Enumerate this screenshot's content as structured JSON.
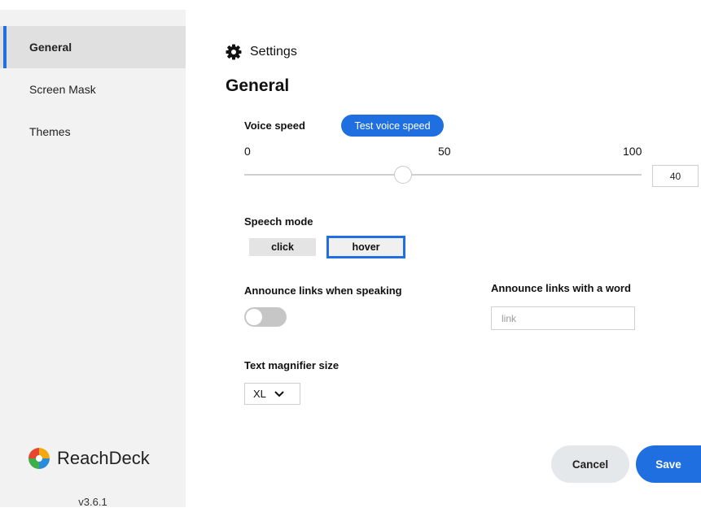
{
  "sidebar": {
    "items": [
      {
        "label": "General",
        "active": true
      },
      {
        "label": "Screen Mask",
        "active": false
      },
      {
        "label": "Themes",
        "active": false
      }
    ],
    "brand_name": "ReachDeck",
    "version": "v3.6.1"
  },
  "header": {
    "title": "Settings",
    "icon": "gear-icon"
  },
  "page_title": "General",
  "voice_speed": {
    "label": "Voice speed",
    "test_button": "Test voice speed",
    "ticks": [
      "0",
      "50",
      "100"
    ],
    "value": 40,
    "value_text": "40",
    "min": 0,
    "max": 100
  },
  "speech_mode": {
    "label": "Speech mode",
    "options": [
      "click",
      "hover"
    ],
    "selected": "hover"
  },
  "announce_links": {
    "label": "Announce links when speaking",
    "enabled": false
  },
  "announce_word": {
    "label": "Announce links with a word",
    "placeholder": "link"
  },
  "magnifier": {
    "label": "Text magnifier size",
    "value": "XL"
  },
  "actions": {
    "cancel": "Cancel",
    "save": "Save"
  },
  "colors": {
    "accent": "#1f6fe0",
    "sidebar_bg": "#f2f2f2"
  }
}
